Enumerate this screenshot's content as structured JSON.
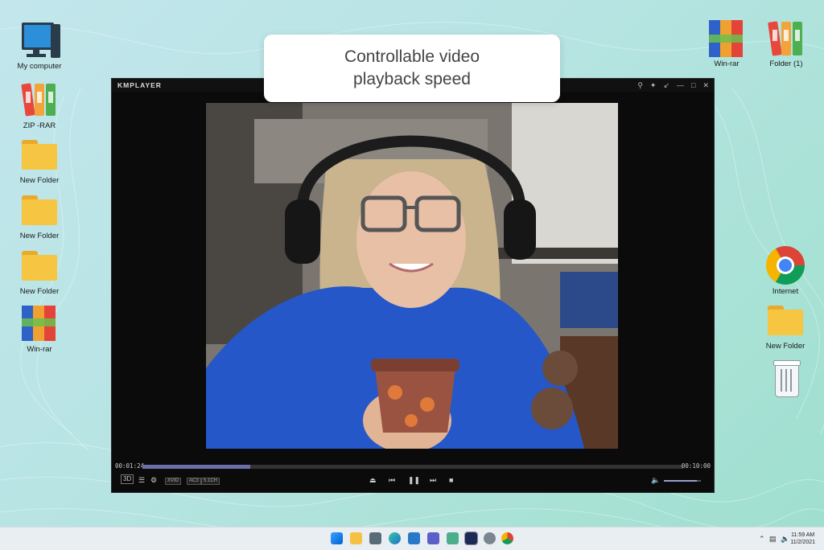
{
  "callout": {
    "line1": "Controllable video",
    "line2": "playback speed"
  },
  "desktop": {
    "left_icons": [
      "My computer",
      "ZIP -RAR",
      "New Folder",
      "New Folder",
      "New Folder",
      "Win-rar"
    ],
    "right_top_icons": [
      "Win-rar",
      "Folder (1)"
    ],
    "right_icons": [
      "Internet",
      "New Folder"
    ]
  },
  "player": {
    "logo": "KMPLAYER",
    "time_elapsed": "00:01:24",
    "time_total": "00:10:00",
    "progress_fraction": 0.2,
    "volume_fraction": 0.9,
    "codec_tags": [
      "XVID",
      "AC3",
      "5.1CH"
    ],
    "btn_3d": "3D"
  },
  "taskbar": {
    "time": "11:59 AM",
    "date": "11/2/2021"
  },
  "icons": {
    "search": "search-icon",
    "pin": "pin-icon",
    "minimize": "minimize-icon",
    "maximize": "maximize-icon",
    "close": "close-icon",
    "eject": "eject-icon",
    "prev": "previous-icon",
    "pause": "pause-icon",
    "next": "next-icon",
    "stop": "stop-icon",
    "volume": "volume-icon",
    "settings": "gear-icon",
    "playlist": "playlist-icon"
  },
  "colors": {
    "seek_fill": "#6b6fa8",
    "folder_yellow": "#f6c542",
    "player_bg": "#0b0b0b"
  }
}
